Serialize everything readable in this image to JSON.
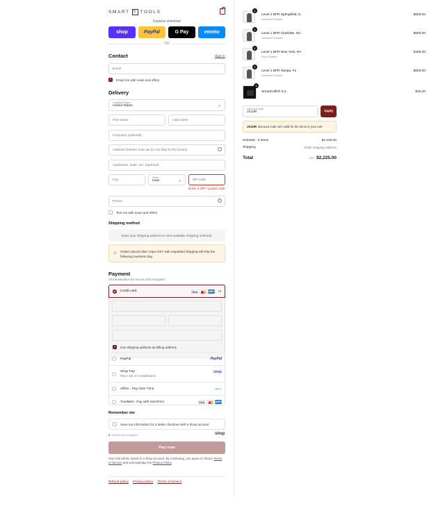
{
  "brand": {
    "logo_left": "SMART",
    "logo_mid": "S",
    "logo_right": "TOOLS"
  },
  "express": {
    "title": "Express checkout",
    "buttons": [
      {
        "label": "shop",
        "bg": "#5a31f4",
        "fg": "#ffffff"
      },
      {
        "label": "PayPal",
        "bg": "#ffc439",
        "fg": "#253b80"
      },
      {
        "label": "G Pay",
        "bg": "#000000",
        "fg": "#ffffff"
      },
      {
        "label": "venmo",
        "bg": "#008cff",
        "fg": "#ffffff"
      }
    ],
    "or": "OR"
  },
  "contact": {
    "heading": "Contact",
    "sign_in": "Sign in",
    "email_placeholder": "Email",
    "newsletter": "Email me with news and offers"
  },
  "delivery": {
    "heading": "Delivery",
    "country_label": "Country/Region",
    "country_value": "United States",
    "first_name": "First name",
    "last_name": "Last name",
    "company": "Company (optional)",
    "address": "Address (Please note we do not ship to PO boxes)",
    "apartment": "Apartment, suite, etc. (optional)",
    "city": "City",
    "state_label": "State",
    "state_value": "Iowa",
    "zip": "ZIP code",
    "zip_error": "Enter a ZIP / postal code",
    "phone": "Phone",
    "sms": "Text me with news and offers"
  },
  "shipping": {
    "heading": "Shipping method",
    "info": "Enter your shipping address to view available shipping methods.",
    "warning": "Orders placed after 12pm EST with expedited shipping will ship the following business day."
  },
  "payment": {
    "heading": "Payment",
    "sub": "All transactions are secure and encrypted.",
    "credit_card": "Credit card",
    "card_icons": [
      {
        "label": "VISA",
        "bg": "#1a1f71"
      },
      {
        "label": "MC",
        "bg": "#eb001b"
      },
      {
        "label": "AMEX",
        "bg": "#2e77bc"
      }
    ],
    "more_cards": "+3",
    "billing_same": "Use shipping address as billing address",
    "options": [
      {
        "label": "PayPal",
        "sub": "",
        "right": "PayPal",
        "right_color": "#253b80"
      },
      {
        "label": "Shop Pay",
        "sub": "Pay in full or in installments",
        "right": "shop",
        "right_color": "#5a31f4"
      },
      {
        "label": "Affirm - Pay Over Time",
        "sub": "",
        "right": "affirm",
        "right_color": "#0fa0ea"
      },
      {
        "label": "TrueMed - Pay with HSA/FSA",
        "sub": "",
        "right": "",
        "right_color": "#000000"
      }
    ]
  },
  "remember": {
    "heading": "Remember me",
    "save_info": "Save my information for a faster checkout with a Shop account",
    "secure": "Secure and encrypted",
    "shop_logo": "shop"
  },
  "pay_now": {
    "label": "Pay now",
    "bg": "#c19a9a"
  },
  "legal": {
    "text_1": "Your info will be saved to a Shop account. By continuing, you agree to Shop's",
    "terms": "Terms of Service",
    "text_2": "and acknowledge the",
    "privacy": "Privacy Policy",
    "text_3": "."
  },
  "footer_links": [
    "Refund policy",
    "Privacy policy",
    "Terms of service"
  ],
  "cart": {
    "items": [
      {
        "qty": "1",
        "name": "Level 1 BFR Springfield, IL",
        "sub": "Licensed Provider",
        "price": "$600.00"
      },
      {
        "qty": "1",
        "name": "Level 1 BFR Charlotte, NC",
        "sub": "Licensed Provider",
        "price": "$600.00"
      },
      {
        "qty": "1",
        "name": "Level 1 BFR New York, NY",
        "sub": "I'm a Student",
        "price": "$400.00"
      },
      {
        "qty": "1",
        "name": "Level 1 BFR Tampa, FL",
        "sub": "Licensed Provider",
        "price": "$600.00"
      },
      {
        "qty": "1",
        "name": "SmartCuffs® 3.0",
        "sub": "",
        "price": "$25.00"
      }
    ],
    "discount_label": "Discount code",
    "discount_value": "JS10R",
    "apply": "Apply",
    "discount_error_code": "JS10R",
    "discount_error_text": "discount code isn't valid for the items in your cart",
    "subtotal_label": "Subtotal · 5 items",
    "subtotal_value": "$2,225.00",
    "shipping_label": "Shipping",
    "shipping_value": "Enter shipping address",
    "total_label": "Total",
    "currency": "USD",
    "total_value": "$2,225.00",
    "accent": "#7a1f1f"
  }
}
